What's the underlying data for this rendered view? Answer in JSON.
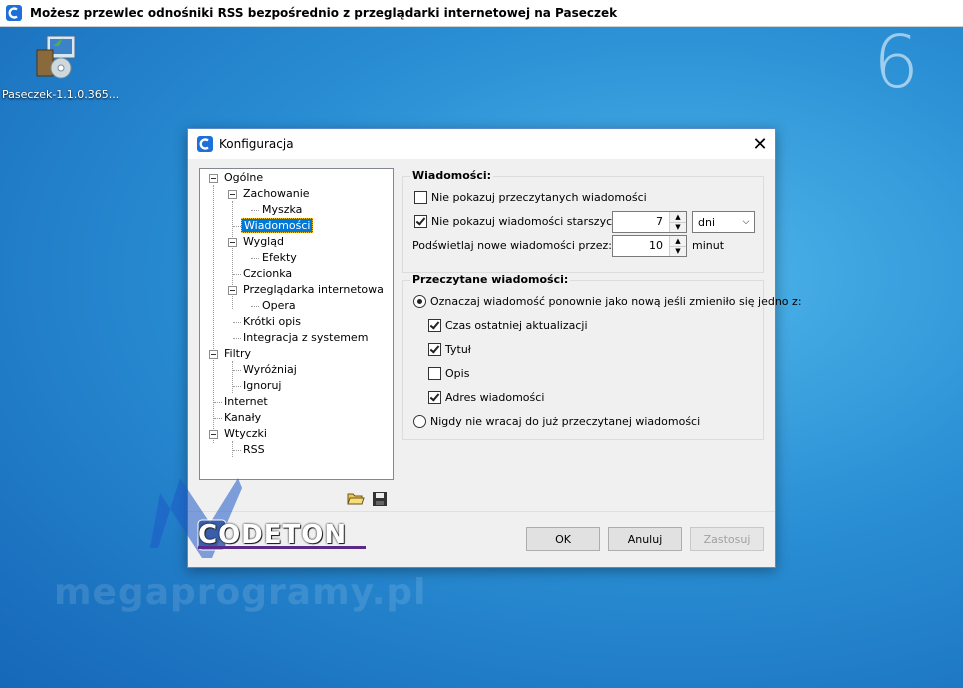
{
  "window": {
    "title": "Możesz przewlec odnośniki RSS bezpośrednio z przeglądarki internetowej na Paseczek",
    "badge": "6"
  },
  "desktop": {
    "icon_label": "Paseczek-1.1.0.365..."
  },
  "dialog": {
    "title": "Konfiguracja",
    "tree": [
      "Ogólne",
      "Zachowanie",
      "Myszka",
      "Wiadomości",
      "Wygląd",
      "Efekty",
      "Czcionka",
      "Przeglądarka internetowa",
      "Opera",
      "Krótki opis",
      "Integracja z systemem",
      "Filtry",
      "Wyróżniaj",
      "Ignoruj",
      "Internet",
      "Kanały",
      "Wtyczki",
      "RSS"
    ],
    "selected": "Wiadomości",
    "messages": {
      "title": "Wiadomości:",
      "hide_read": "Nie pokazuj przeczytanych wiadomości",
      "hide_older": "Nie pokazuj wiadomości starszych niż:",
      "older_value": "7",
      "older_unit": "dni",
      "highlight": "Podświetlaj nowe wiadomości przez:",
      "highlight_value": "10",
      "highlight_unit": "minut"
    },
    "read": {
      "title": "Przeczytane wiadomości:",
      "mark_again": "Oznaczaj wiadomość ponownie jako nową jeśli zmieniło się jedno z:",
      "opt_time": "Czas ostatniej aktualizacji",
      "opt_title": "Tytuł",
      "opt_desc": "Opis",
      "opt_addr": "Adres wiadomości",
      "never": "Nigdy nie wracaj do już przeczytanej wiadomości"
    },
    "buttons": {
      "ok": "OK",
      "cancel": "Anuluj",
      "apply": "Zastosuj"
    }
  },
  "watermark": {
    "logo": "CODETON",
    "site": "megaprogramy.pl"
  },
  "colors": {
    "selection": "#0078d7",
    "app_icon": "#1e6fd9"
  }
}
